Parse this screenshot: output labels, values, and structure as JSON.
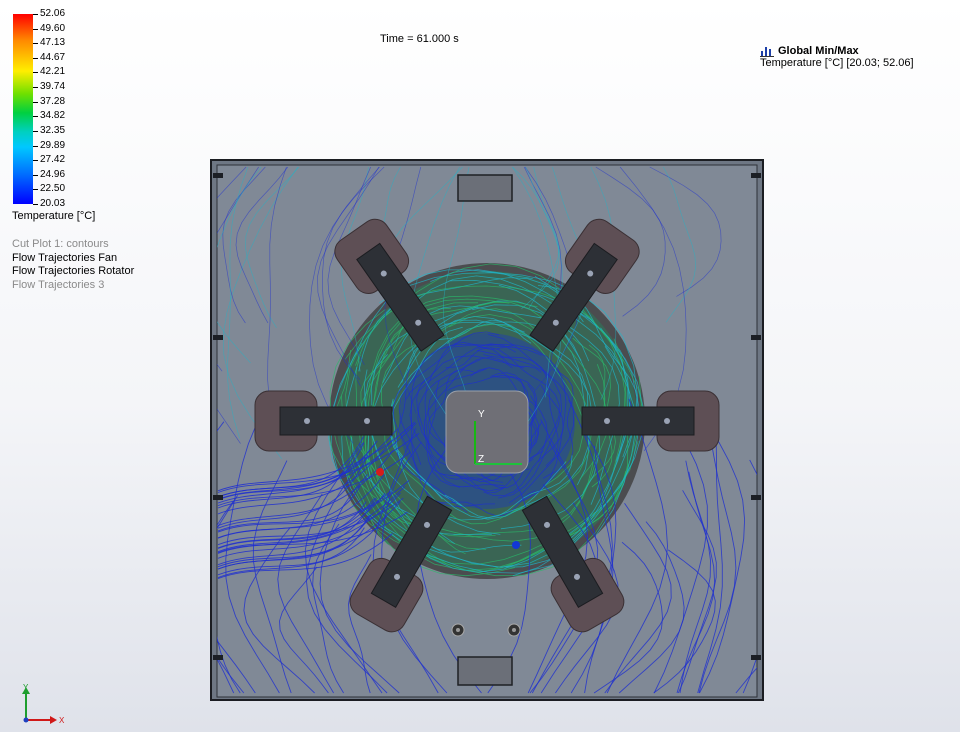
{
  "legend": {
    "ticks": [
      "52.06",
      "49.60",
      "47.13",
      "44.67",
      "42.21",
      "39.74",
      "37.28",
      "34.82",
      "32.35",
      "29.89",
      "27.42",
      "24.96",
      "22.50",
      "20.03"
    ],
    "title": "Temperature [°C]"
  },
  "plots": [
    {
      "label": "Cut Plot 1: contours",
      "active": false
    },
    {
      "label": "Flow Trajectories Fan",
      "active": true
    },
    {
      "label": "Flow Trajectories Rotator",
      "active": true
    },
    {
      "label": "Flow Trajectories 3",
      "active": false
    }
  ],
  "time_label": "Time = 61.000 s",
  "minmax": {
    "title": "Global Min/Max",
    "value": "Temperature [°C] [20.03; 52.06]",
    "icon": "chart-icon"
  },
  "model": {
    "center_triad": {
      "y": "Y",
      "z": "Z"
    }
  },
  "triad": {
    "x": "X",
    "y": "Y"
  },
  "colors": {
    "housing": "#7f8895",
    "ring": "#4a4a4c",
    "blade": "#2d3036",
    "pad": "#5e4f55",
    "hub": "#6f6f76",
    "streak_blue": "#1e2fd0",
    "streak_cyan": "#1fb5c8",
    "streak_green": "#2ab86a"
  }
}
